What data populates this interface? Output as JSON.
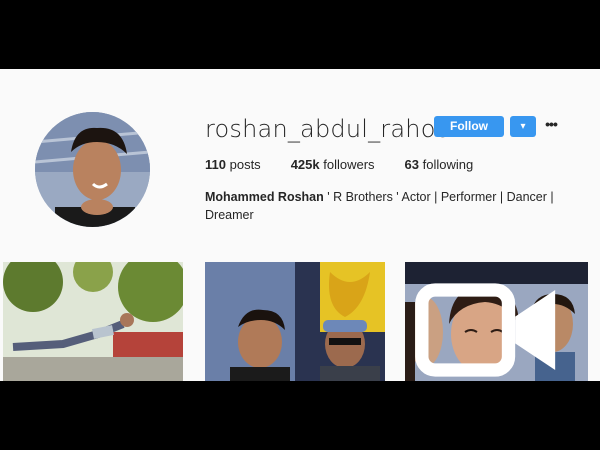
{
  "profile": {
    "username": "roshan_abdul_rahoof",
    "follow_label": "Follow",
    "dropdown_icon": "▾",
    "more_icon": "•••",
    "stats": [
      {
        "count": "110",
        "label": "posts"
      },
      {
        "count": "425k",
        "label": "followers"
      },
      {
        "count": "63",
        "label": "following"
      }
    ],
    "full_name": "Mohammed Roshan",
    "bio": " ' R Brothers ' Actor | Performer | Dancer | Dreamer"
  },
  "colors": {
    "accent": "#3897f0",
    "background": "#fafafa",
    "text": "#262626"
  },
  "icons": {
    "avatar": "profile-avatar",
    "video": "video-icon"
  }
}
